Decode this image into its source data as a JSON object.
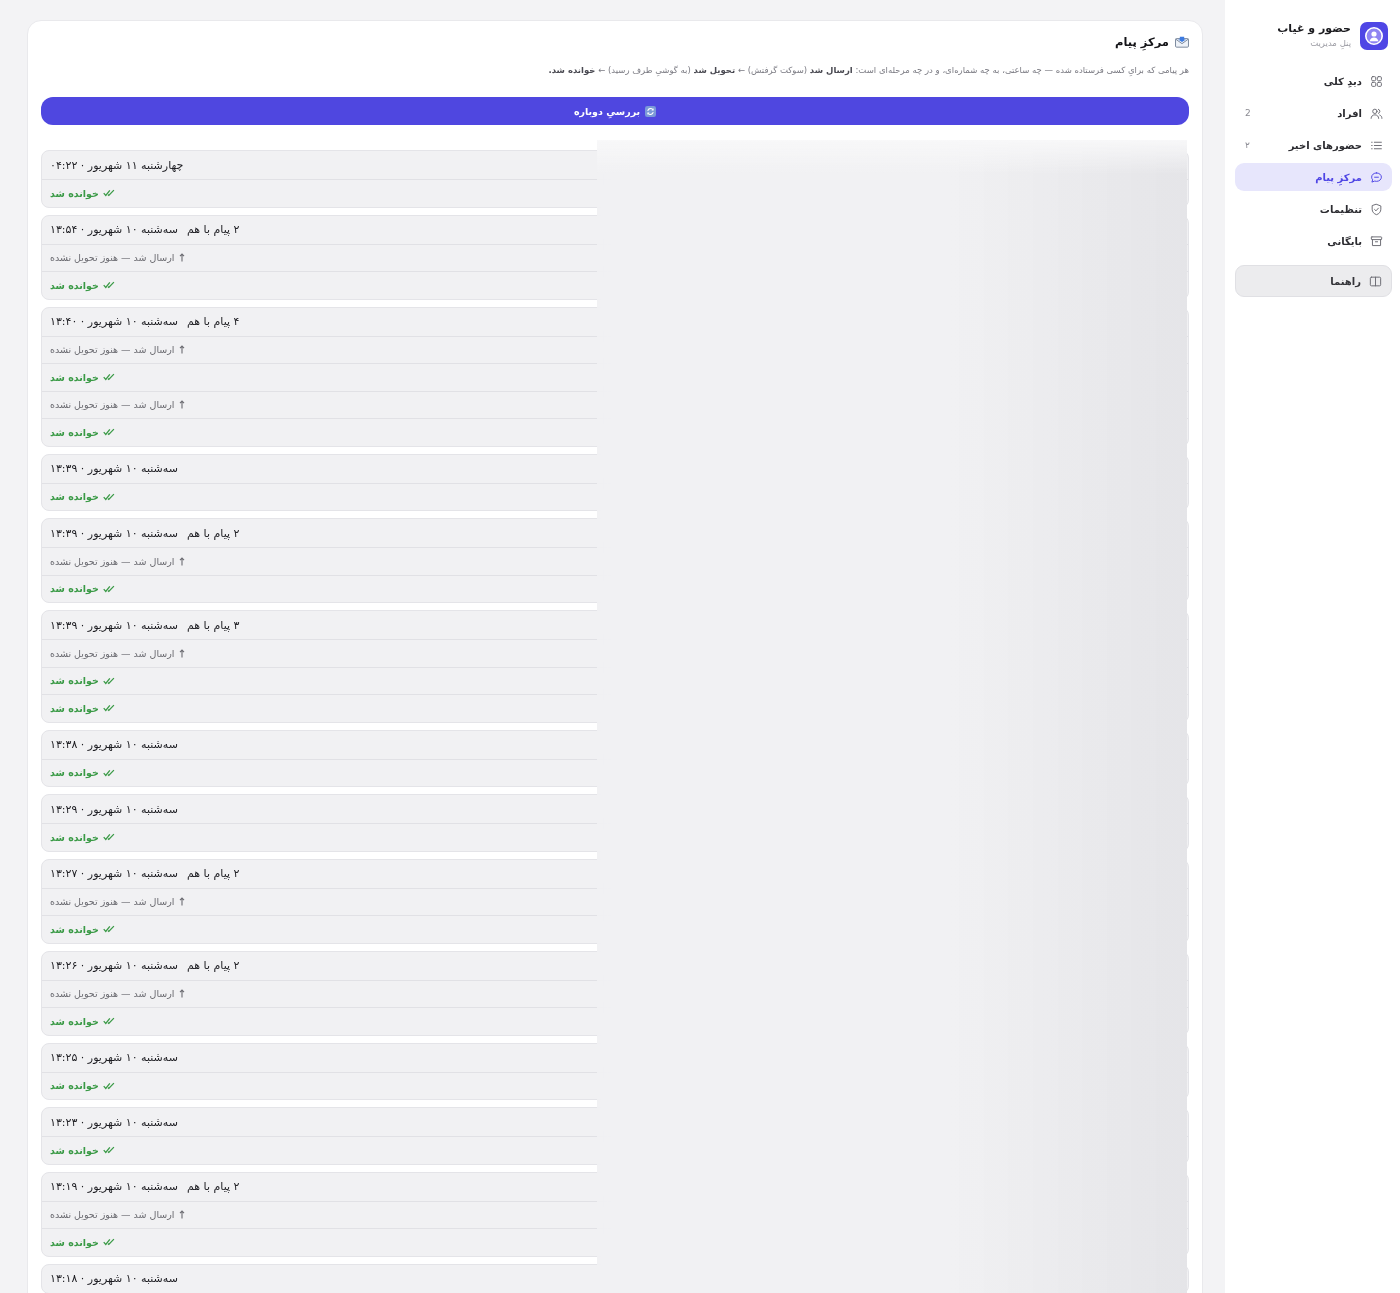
{
  "sidebar": {
    "app_title": "حضور و غیاب",
    "app_subtitle": "پنلِ مدیریت",
    "items": [
      {
        "label": "دیدِ کلی",
        "selected": false
      },
      {
        "label": "افراد",
        "count": "2",
        "selected": false
      },
      {
        "label": "حضورهای اخیر",
        "count": "۲",
        "selected": false
      },
      {
        "label": "مرکزِ پیام",
        "selected": true
      },
      {
        "label": "تنظیمات",
        "selected": false
      },
      {
        "label": "بایگانی",
        "selected": false
      }
    ],
    "help_button": "راهنما"
  },
  "main": {
    "title": "مرکزِ پیام",
    "description": "هر پیامی که برایِ کسی فرستاده شده — چه ساعتی، به چه شماره‌ای، و در چه مرحله‌ای است: **ارسال شد** (سوکت گرفتش) ← **تحویل شد** (به گوشیِ طرف رسید) ← **خوانده شد.**",
    "refresh_button": "بررسیِ دوباره",
    "groups": [
      {
        "time": "چهارشنبه ۱۱ شهریور · ۰۴:۲۲",
        "messages": [
          {
            "kind": "read",
            "status": "خوانده شد"
          }
        ]
      },
      {
        "count_label": "۲ پیام با هم",
        "time": "سه‌شنبه ۱۰ شهریور · ۱۳:۵۴",
        "messages": [
          {
            "kind": "sent",
            "status": "ارسال شد — هنوز تحویل نشده"
          },
          {
            "kind": "read",
            "status": "خوانده شد"
          }
        ]
      },
      {
        "count_label": "۴ پیام با هم",
        "time": "سه‌شنبه ۱۰ شهریور · ۱۳:۴۰",
        "messages": [
          {
            "kind": "sent",
            "status": "ارسال شد — هنوز تحویل نشده"
          },
          {
            "kind": "read",
            "status": "خوانده شد"
          },
          {
            "kind": "sent",
            "status": "ارسال شد — هنوز تحویل نشده"
          },
          {
            "kind": "read",
            "status": "خوانده شد"
          }
        ]
      },
      {
        "time": "سه‌شنبه ۱۰ شهریور · ۱۳:۳۹",
        "messages": [
          {
            "kind": "read",
            "status": "خوانده شد"
          }
        ]
      },
      {
        "count_label": "۲ پیام با هم",
        "time": "سه‌شنبه ۱۰ شهریور · ۱۳:۳۹",
        "messages": [
          {
            "kind": "sent",
            "status": "ارسال شد — هنوز تحویل نشده"
          },
          {
            "kind": "read",
            "status": "خوانده شد"
          }
        ]
      },
      {
        "count_label": "۳ پیام با هم",
        "time": "سه‌شنبه ۱۰ شهریور · ۱۳:۳۹",
        "messages": [
          {
            "kind": "sent",
            "status": "ارسال شد — هنوز تحویل نشده"
          },
          {
            "kind": "read",
            "status": "خوانده شد"
          },
          {
            "kind": "read",
            "status": "خوانده شد"
          }
        ]
      },
      {
        "time": "سه‌شنبه ۱۰ شهریور · ۱۳:۳۸",
        "messages": [
          {
            "kind": "read",
            "status": "خوانده شد"
          }
        ]
      },
      {
        "time": "سه‌شنبه ۱۰ شهریور · ۱۳:۲۹",
        "messages": [
          {
            "kind": "read",
            "status": "خوانده شد"
          }
        ]
      },
      {
        "count_label": "۲ پیام با هم",
        "time": "سه‌شنبه ۱۰ شهریور · ۱۳:۲۷",
        "messages": [
          {
            "kind": "sent",
            "status": "ارسال شد — هنوز تحویل نشده"
          },
          {
            "kind": "read",
            "status": "خوانده شد"
          }
        ]
      },
      {
        "count_label": "۲ پیام با هم",
        "time": "سه‌شنبه ۱۰ شهریور · ۱۳:۲۶",
        "messages": [
          {
            "kind": "sent",
            "status": "ارسال شد — هنوز تحویل نشده"
          },
          {
            "kind": "read",
            "status": "خوانده شد"
          }
        ]
      },
      {
        "time": "سه‌شنبه ۱۰ شهریور · ۱۳:۲۵",
        "messages": [
          {
            "kind": "read",
            "status": "خوانده شد"
          }
        ]
      },
      {
        "time": "سه‌شنبه ۱۰ شهریور · ۱۳:۲۳",
        "messages": [
          {
            "kind": "read",
            "status": "خوانده شد"
          }
        ]
      },
      {
        "count_label": "۲ پیام با هم",
        "time": "سه‌شنبه ۱۰ شهریور · ۱۳:۱۹",
        "messages": [
          {
            "kind": "sent",
            "status": "ارسال شد — هنوز تحویل نشده"
          },
          {
            "kind": "read",
            "status": "خوانده شد"
          }
        ]
      },
      {
        "time": "سه‌شنبه ۱۰ شهریور · ۱۳:۱۸"
      }
    ]
  }
}
